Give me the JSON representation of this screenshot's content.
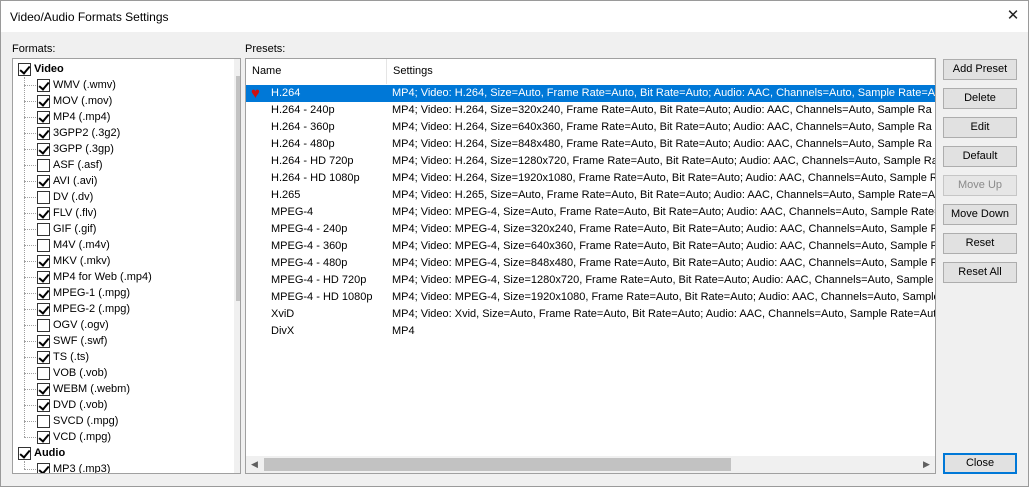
{
  "window": {
    "title": "Video/Audio Formats Settings",
    "close_glyph": "✕"
  },
  "formats": {
    "label": "Formats:",
    "groups": [
      {
        "name": "Video",
        "checked": true,
        "items": [
          {
            "label": "WMV (.wmv)",
            "checked": true
          },
          {
            "label": "MOV (.mov)",
            "checked": true
          },
          {
            "label": "MP4 (.mp4)",
            "checked": true
          },
          {
            "label": "3GPP2 (.3g2)",
            "checked": true
          },
          {
            "label": "3GPP (.3gp)",
            "checked": true
          },
          {
            "label": "ASF (.asf)",
            "checked": false
          },
          {
            "label": "AVI (.avi)",
            "checked": true
          },
          {
            "label": "DV (.dv)",
            "checked": false
          },
          {
            "label": "FLV (.flv)",
            "checked": true
          },
          {
            "label": "GIF (.gif)",
            "checked": false
          },
          {
            "label": "M4V (.m4v)",
            "checked": false
          },
          {
            "label": "MKV (.mkv)",
            "checked": true
          },
          {
            "label": "MP4 for Web (.mp4)",
            "checked": true
          },
          {
            "label": "MPEG-1 (.mpg)",
            "checked": true
          },
          {
            "label": "MPEG-2 (.mpg)",
            "checked": true
          },
          {
            "label": "OGV (.ogv)",
            "checked": false
          },
          {
            "label": "SWF (.swf)",
            "checked": true
          },
          {
            "label": "TS (.ts)",
            "checked": true
          },
          {
            "label": "VOB (.vob)",
            "checked": false
          },
          {
            "label": "WEBM (.webm)",
            "checked": true
          },
          {
            "label": "DVD (.vob)",
            "checked": true
          },
          {
            "label": "SVCD (.mpg)",
            "checked": false
          },
          {
            "label": "VCD (.mpg)",
            "checked": true
          }
        ]
      },
      {
        "name": "Audio",
        "checked": true,
        "items": [
          {
            "label": "MP3 (.mp3)",
            "checked": true
          }
        ]
      }
    ]
  },
  "presets": {
    "label": "Presets:",
    "columns": [
      "Name",
      "Settings"
    ],
    "selected_index": 0,
    "rows": [
      {
        "name": "H.264",
        "settings": "MP4; Video: H.264, Size=Auto, Frame Rate=Auto, Bit Rate=Auto; Audio: AAC, Channels=Auto, Sample Rate=A"
      },
      {
        "name": "H.264 - 240p",
        "settings": "MP4; Video: H.264, Size=320x240, Frame Rate=Auto, Bit Rate=Auto; Audio: AAC, Channels=Auto, Sample Ra"
      },
      {
        "name": "H.264 - 360p",
        "settings": "MP4; Video: H.264, Size=640x360, Frame Rate=Auto, Bit Rate=Auto; Audio: AAC, Channels=Auto, Sample Ra"
      },
      {
        "name": "H.264 - 480p",
        "settings": "MP4; Video: H.264, Size=848x480, Frame Rate=Auto, Bit Rate=Auto; Audio: AAC, Channels=Auto, Sample Ra"
      },
      {
        "name": "H.264 - HD 720p",
        "settings": "MP4; Video: H.264, Size=1280x720, Frame Rate=Auto, Bit Rate=Auto; Audio: AAC, Channels=Auto, Sample Ra"
      },
      {
        "name": "H.264 - HD 1080p",
        "settings": "MP4; Video: H.264, Size=1920x1080, Frame Rate=Auto, Bit Rate=Auto; Audio: AAC, Channels=Auto, Sample Ra"
      },
      {
        "name": "H.265",
        "settings": "MP4; Video: H.265, Size=Auto, Frame Rate=Auto, Bit Rate=Auto; Audio: AAC, Channels=Auto, Sample Rate=Au"
      },
      {
        "name": "MPEG-4",
        "settings": "MP4; Video: MPEG-4, Size=Auto, Frame Rate=Auto, Bit Rate=Auto; Audio: AAC, Channels=Auto, Sample Rate=A"
      },
      {
        "name": "MPEG-4 - 240p",
        "settings": "MP4; Video: MPEG-4, Size=320x240, Frame Rate=Auto, Bit Rate=Auto; Audio: AAC, Channels=Auto, Sample Ra"
      },
      {
        "name": "MPEG-4 - 360p",
        "settings": "MP4; Video: MPEG-4, Size=640x360, Frame Rate=Auto, Bit Rate=Auto; Audio: AAC, Channels=Auto, Sample Ra"
      },
      {
        "name": "MPEG-4 - 480p",
        "settings": "MP4; Video: MPEG-4, Size=848x480, Frame Rate=Auto, Bit Rate=Auto; Audio: AAC, Channels=Auto, Sample Ra"
      },
      {
        "name": "MPEG-4 - HD 720p",
        "settings": "MP4; Video: MPEG-4, Size=1280x720, Frame Rate=Auto, Bit Rate=Auto; Audio: AAC, Channels=Auto, Sample R"
      },
      {
        "name": "MPEG-4 - HD 1080p",
        "settings": "MP4; Video: MPEG-4, Size=1920x1080, Frame Rate=Auto, Bit Rate=Auto; Audio: AAC, Channels=Auto, Sample"
      },
      {
        "name": "XviD",
        "settings": "MP4; Video: Xvid, Size=Auto, Frame Rate=Auto, Bit Rate=Auto; Audio: AAC, Channels=Auto, Sample Rate=Aut"
      },
      {
        "name": "DivX",
        "settings": "MP4"
      }
    ]
  },
  "buttons": {
    "add_preset": "Add Preset",
    "delete": "Delete",
    "edit": "Edit",
    "default": "Default",
    "move_up": "Move Up",
    "move_down": "Move Down",
    "reset": "Reset",
    "reset_all": "Reset All",
    "close": "Close"
  },
  "icons": {
    "favorite": "heart-icon",
    "scroll_up": "▲",
    "scroll_down": "▼",
    "scroll_left": "◀",
    "scroll_right": "▶"
  },
  "colors": {
    "selection": "#0078d7",
    "heart": "#d01010"
  }
}
